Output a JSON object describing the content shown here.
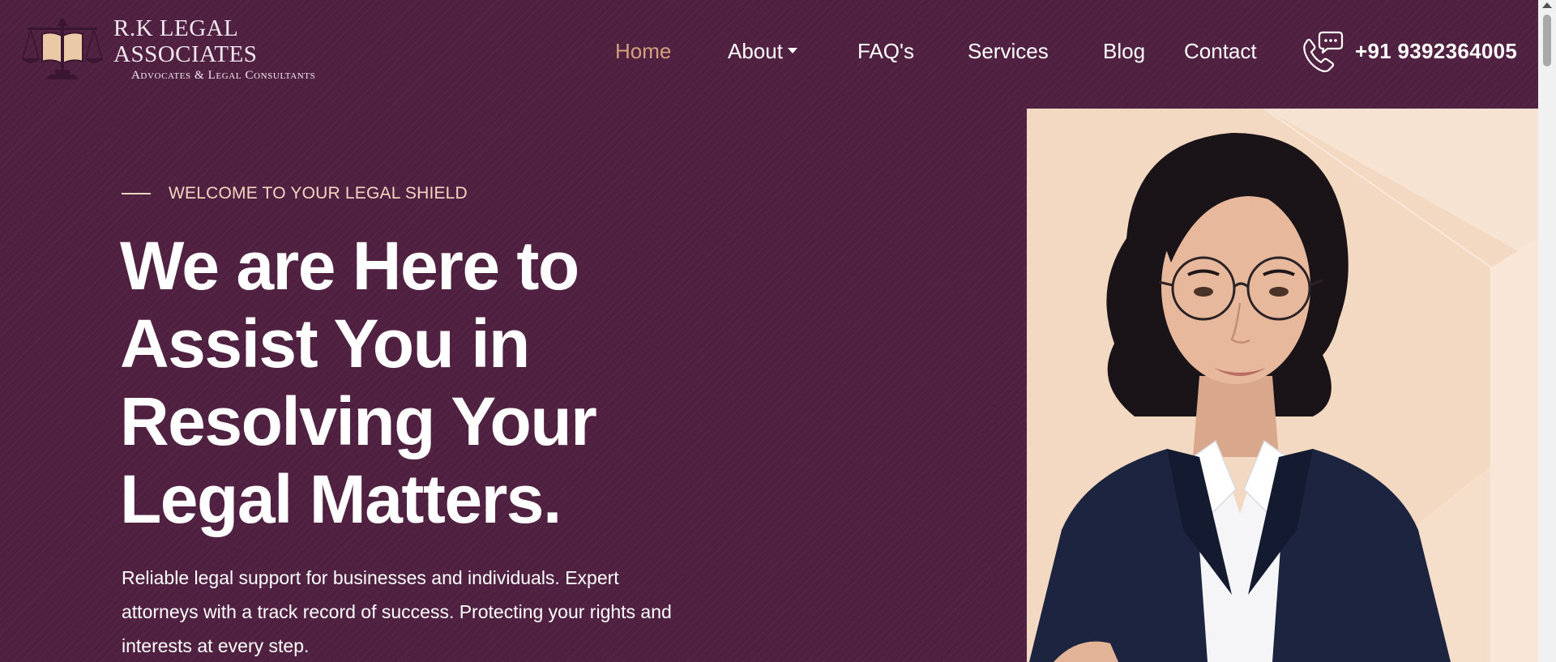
{
  "brand": {
    "name": "R.K LEGAL ASSOCIATES",
    "tagline": "Advocates & Legal Consultants",
    "logo_icon": "scales-of-justice-book-icon"
  },
  "nav": {
    "items": [
      {
        "label": "Home",
        "active": true
      },
      {
        "label": "About",
        "has_dropdown": true
      },
      {
        "label": "FAQ's"
      },
      {
        "label": "Services"
      },
      {
        "label": "Blog"
      },
      {
        "label": "Contact"
      }
    ],
    "phone_icon": "phone-chat-icon",
    "phone": "+91  9392364005"
  },
  "hero": {
    "eyebrow": "WELCOME TO YOUR LEGAL SHIELD",
    "headline_lines": [
      "We are Here to",
      "Assist You in",
      "Resolving Your",
      "Legal Matters."
    ],
    "description_lines": [
      "Reliable legal support for businesses and individuals. Expert",
      "attorneys with a track record of success. Protecting your rights and",
      "interests at every step."
    ],
    "image": "woman-lawyer-portrait"
  },
  "colors": {
    "background": "#502040",
    "accent": "#d4a17f",
    "eyebrow": "#f3d6c1",
    "image_panel": "#f3d9c2",
    "text": "#ffffff"
  }
}
